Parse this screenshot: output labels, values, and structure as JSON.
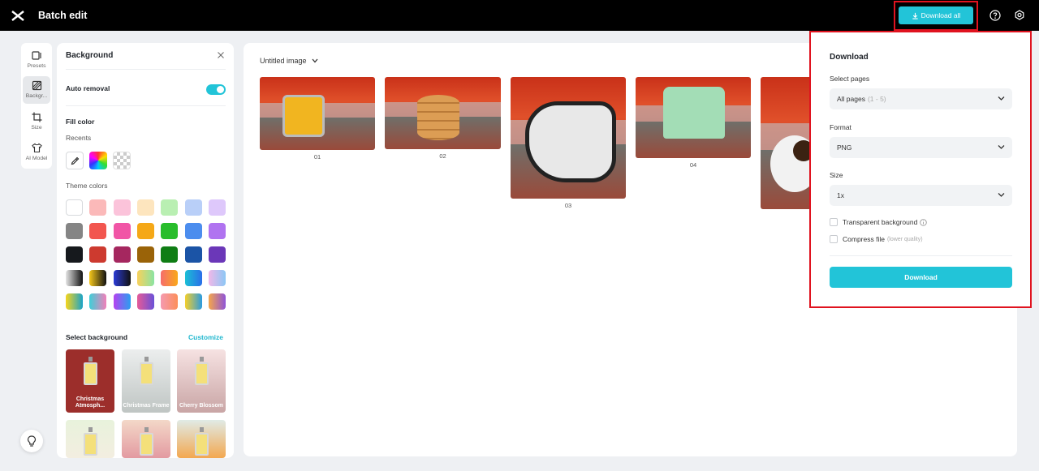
{
  "header": {
    "title": "Batch edit",
    "download_all_label": "Download all"
  },
  "rail": {
    "items": [
      {
        "label": "Presets"
      },
      {
        "label": "Backgr..."
      },
      {
        "label": "Size"
      },
      {
        "label": "AI Model"
      }
    ]
  },
  "panel": {
    "title": "Background",
    "auto_removal_label": "Auto removal",
    "auto_removal_on": true,
    "fill_color_label": "Fill color",
    "recents_label": "Recents",
    "theme_colors_label": "Theme colors",
    "theme_colors": [
      [
        "#ffffff",
        "#fbb9b9",
        "#fbc3da",
        "#fde5be",
        "#b9efb2",
        "#b9cff8",
        "#dec8fb"
      ],
      [
        "#858585",
        "#f2564f",
        "#f155a6",
        "#f5a817",
        "#28bd2b",
        "#4c8dee",
        "#b073f0"
      ],
      [
        "#16191d",
        "#cd3a2f",
        "#a5275f",
        "#9a6308",
        "#0f7d14",
        "#1b54a6",
        "#6b37b8"
      ]
    ],
    "gradient_rows": [
      [
        "linear-gradient(90deg,#e5e5e5,#111)",
        "linear-gradient(90deg,#f5c71a,#111)",
        "linear-gradient(90deg,#2b3bd6,#111)",
        "linear-gradient(90deg,#f9d15b,#8ae4a3)",
        "linear-gradient(90deg,#f66d6d,#f9a81a)",
        "linear-gradient(90deg,#1bc0d6,#2a6ee8)",
        "linear-gradient(90deg,#f0b8e8,#8cc7f5)"
      ],
      [
        "linear-gradient(90deg,#f7d51b,#19a3c9)",
        "linear-gradient(90deg,#3fcfd8,#f27fb9)",
        "linear-gradient(90deg,#b542f0,#2a9ff0)",
        "linear-gradient(90deg,#e65a97,#6a51d8)",
        "linear-gradient(90deg,#f59ab1,#fc8e5a)",
        "linear-gradient(90deg,#f5cf2a,#2a9be0)",
        "linear-gradient(90deg,#f5a54a,#8f54d8)"
      ]
    ],
    "select_background_label": "Select background",
    "customize_label": "Customize",
    "backgrounds": [
      {
        "label": "Christmas Atmosph...",
        "color": "#9c2e2b"
      },
      {
        "label": "Christmas Frame",
        "color": "#d7dcdc"
      },
      {
        "label": "Cherry Blossom",
        "color": "#f2d6d6"
      }
    ]
  },
  "canvas": {
    "doc_title": "Untitled image",
    "pages": [
      {
        "number": "01",
        "object_color": "#f1b520"
      },
      {
        "number": "02",
        "object_color": "#dc9d54"
      },
      {
        "number": "03",
        "object_color": "#e8e8e8"
      },
      {
        "number": "04",
        "object_color": "#a3ddb6"
      },
      {
        "number": "",
        "object_color": "#f2f2f2"
      }
    ]
  },
  "download_panel": {
    "title": "Download",
    "select_pages_label": "Select pages",
    "pages_value": "All pages",
    "pages_hint": "(1 - 5)",
    "format_label": "Format",
    "format_value": "PNG",
    "size_label": "Size",
    "size_value": "1x",
    "transparent_label": "Transparent background",
    "compress_label": "Compress file",
    "compress_hint": "(lower quality)",
    "download_label": "Download"
  },
  "colors": {
    "accent": "#22c4d8",
    "highlight": "#e0131f"
  }
}
